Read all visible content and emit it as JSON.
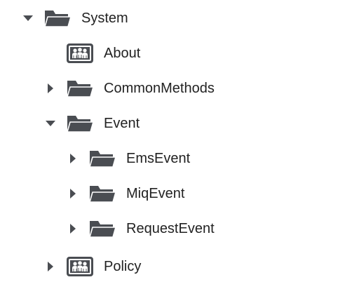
{
  "colors": {
    "icon": "#4a4d52",
    "toggle": "#4a4d52",
    "text": "#222222",
    "background": "#ffffff"
  },
  "tree": {
    "system": {
      "label": "System",
      "icon": "folder-open-icon",
      "expanded": true,
      "children": {
        "about": {
          "label": "About",
          "icon": "class-instance-icon"
        },
        "common_methods": {
          "label": "CommonMethods",
          "icon": "folder-open-icon",
          "expanded": false
        },
        "event": {
          "label": "Event",
          "icon": "folder-open-icon",
          "expanded": true,
          "children": {
            "ems_event": {
              "label": "EmsEvent",
              "icon": "folder-open-icon",
              "expanded": false
            },
            "miq_event": {
              "label": "MiqEvent",
              "icon": "folder-open-icon",
              "expanded": false
            },
            "request_event": {
              "label": "RequestEvent",
              "icon": "folder-open-icon",
              "expanded": false
            }
          }
        },
        "policy": {
          "label": "Policy",
          "icon": "class-instance-icon",
          "expanded": false
        }
      }
    }
  }
}
